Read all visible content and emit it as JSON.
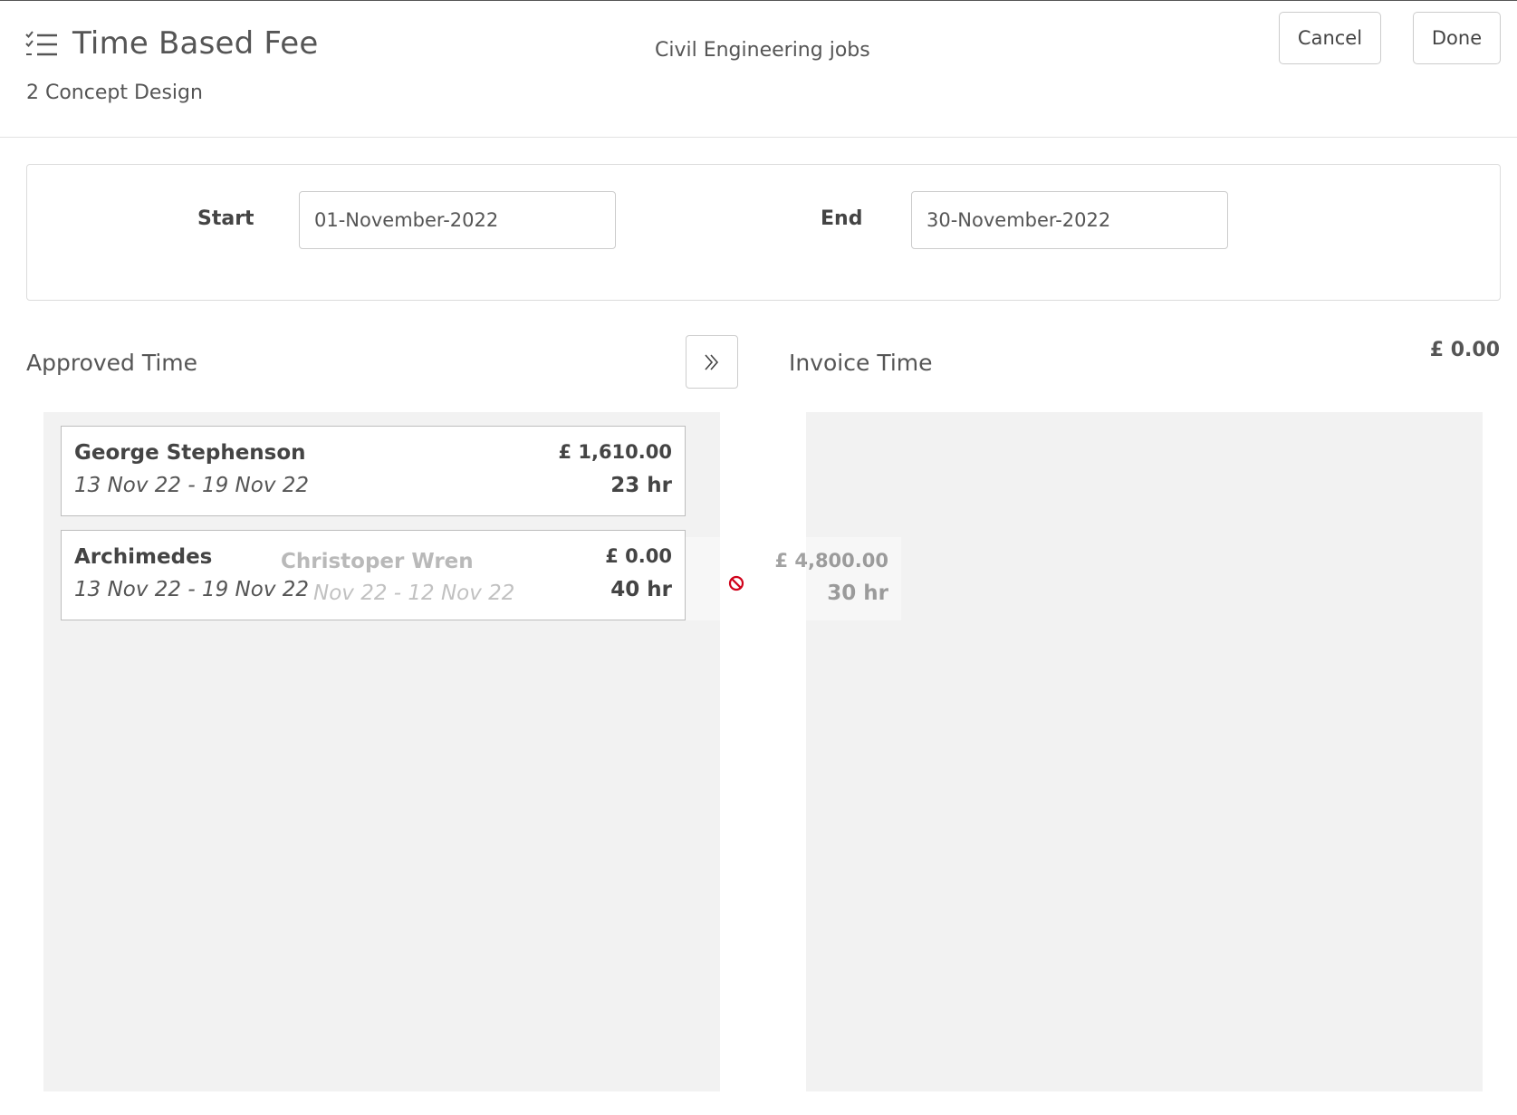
{
  "header": {
    "title": "Time Based Fee",
    "subtitle": "2 Concept Design",
    "center_title": "Civil Engineering jobs",
    "cancel_label": "Cancel",
    "done_label": "Done",
    "icon": "checklist-icon"
  },
  "dates": {
    "start_label": "Start",
    "start_value": "01-November-2022",
    "end_label": "End",
    "end_value": "30-November-2022"
  },
  "approved": {
    "heading": "Approved Time",
    "items": [
      {
        "name": "George Stephenson",
        "range": "13 Nov 22 - 19 Nov 22",
        "amount": "£ 1,610.00",
        "hours": "23 hr"
      },
      {
        "name": "Archimedes",
        "range": "13 Nov 22 - 19 Nov 22",
        "amount": "£ 0.00",
        "hours": "40 hr"
      }
    ]
  },
  "move_button_icon": "double-chevron-right-icon",
  "invoice": {
    "heading": "Invoice Time",
    "total": "£ 0.00",
    "items": []
  },
  "dragging": {
    "name": "Christoper Wren",
    "range": "Nov 22 - 12 Nov 22",
    "amount": "£ 4,800.00",
    "hours": "30 hr",
    "cursor_icon": "no-drop-icon"
  },
  "colors": {
    "panel_bg": "#f2f2f2",
    "border": "#cccccc",
    "no_drop": "#d0021b"
  }
}
